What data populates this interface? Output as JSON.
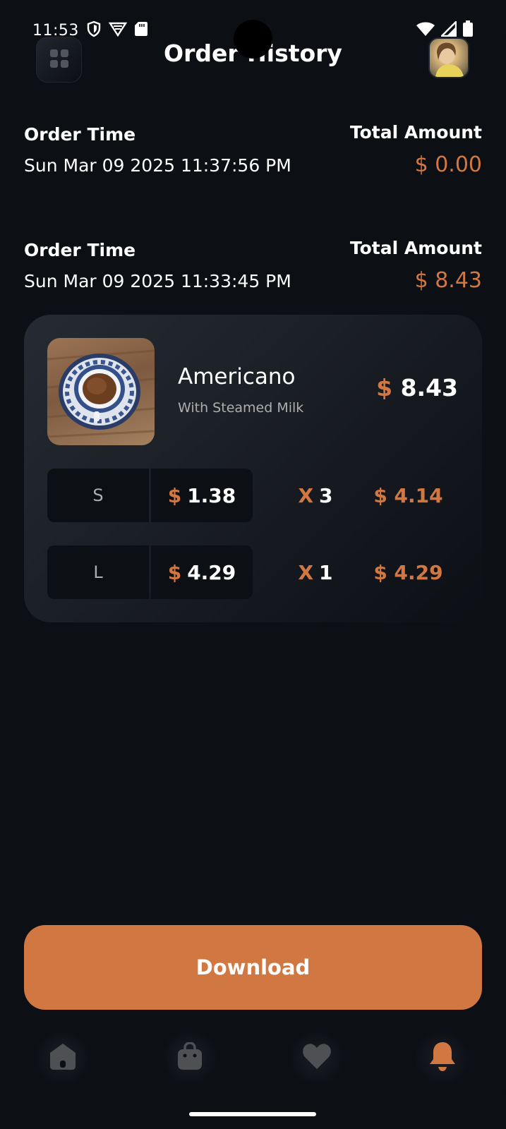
{
  "status_bar": {
    "time": "11:53",
    "icons": [
      "shield-icon",
      "vpn-icon",
      "sd-card-icon",
      "wifi-icon",
      "signal-icon",
      "battery-icon"
    ]
  },
  "header": {
    "title": "Order History",
    "menu_icon": "grid-icon",
    "avatar": "user-avatar"
  },
  "orders": [
    {
      "time_label": "Order Time",
      "time_value": "Sun Mar 09 2025 11:37:56 PM",
      "total_label": "Total Amount",
      "total_value": "$ 0.00"
    },
    {
      "time_label": "Order Time",
      "time_value": "Sun Mar 09 2025 11:33:45 PM",
      "total_label": "Total Amount",
      "total_value": "$ 8.43",
      "items": [
        {
          "name": "Americano",
          "description": "With Steamed Milk",
          "currency": "$",
          "price": "8.43",
          "sizes": [
            {
              "size": "S",
              "currency": "$",
              "price": "1.38",
              "x": "X",
              "quantity": "3",
              "total": "$ 4.14"
            },
            {
              "size": "L",
              "currency": "$",
              "price": "4.29",
              "x": "X",
              "quantity": "1",
              "total": "$ 4.29"
            }
          ]
        }
      ]
    }
  ],
  "download_button": {
    "label": "Download"
  },
  "bottom_nav": [
    {
      "icon": "home-icon",
      "active": false
    },
    {
      "icon": "shopping-bag-icon",
      "active": false
    },
    {
      "icon": "heart-icon",
      "active": false
    },
    {
      "icon": "bell-icon",
      "active": true
    }
  ],
  "colors": {
    "background": "#0c0f14",
    "accent": "#d17842",
    "card": "#262b33",
    "muted_text": "#aeaeae",
    "inactive_icon": "#4e5053"
  }
}
